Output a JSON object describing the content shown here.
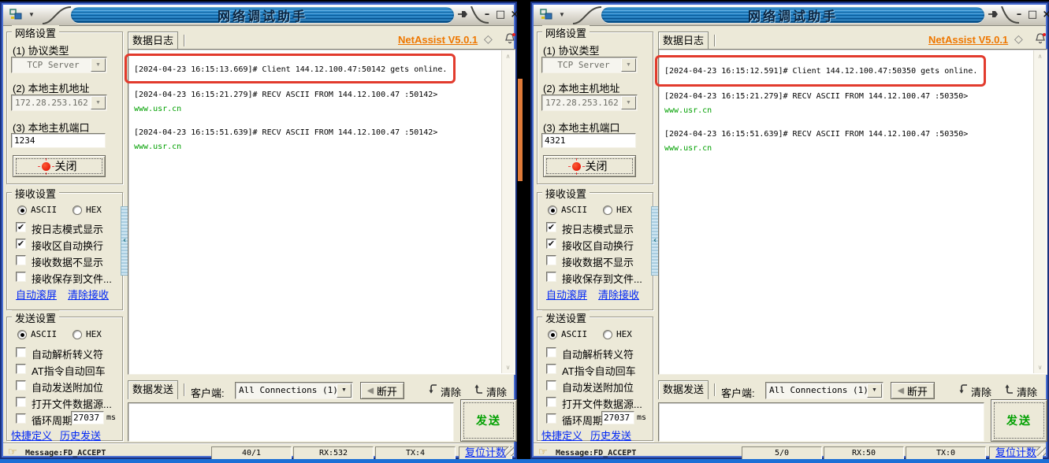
{
  "labels": {
    "title": "网络调试助手",
    "brand": "NetAssist V5.0.1",
    "net_group": "网络设置",
    "protocol_label": "(1) 协议类型",
    "protocol_value": "TCP Server",
    "address_label": "(2) 本地主机地址",
    "address_value": "172.28.253.162",
    "port_label": "(3) 本地主机端口",
    "close_btn": "关闭",
    "recv_group": "接收设置",
    "ascii": "ASCII",
    "hex": "HEX",
    "recv_opts": [
      "按日志模式显示",
      "接收区自动换行",
      "接收数据不显示",
      "接收保存到文件..."
    ],
    "recv_link_scroll": "自动滚屏",
    "recv_link_clear": "清除接收",
    "send_group": "发送设置",
    "send_opts": [
      "自动解析转义符",
      "AT指令自动回车",
      "自动发送附加位",
      "打开文件数据源...",
      "循环周期"
    ],
    "ms_unit": "ms",
    "send_link_quick": "快捷定义",
    "send_link_history": "历史发送",
    "log_tab": "数据日志",
    "send_tab": "数据发送",
    "client_label": "客户端:",
    "client_value": "All Connections (1)",
    "disconnect": "断开",
    "clear": "清除",
    "send_btn": "发送",
    "reset_count": "复位计数",
    "status_message": "Message:FD_ACCEPT"
  },
  "icons": {
    "dropdown": "▼",
    "combo_arrow": "▼",
    "minimize": "–",
    "maximize": "□",
    "close": "×",
    "chevron_left": "‹",
    "scroll_up": "∧",
    "scroll_down": "∨",
    "disconnect_arrow": "◀",
    "status_pointer": "☞",
    "check": "✔",
    "diamond": "◇"
  },
  "windows": [
    {
      "port": "1234",
      "cycle": "27037",
      "log": [
        "[2024-04-23 16:15:13.669]# Client 144.12.100.47:50142 gets online.",
        "[2024-04-23 16:15:21.279]# RECV ASCII FROM 144.12.100.47 :50142>",
        "www.usr.cn",
        "[2024-04-23 16:15:51.639]# RECV ASCII FROM 144.12.100.47 :50142>",
        "www.usr.cn"
      ],
      "counters": {
        "pair": "40/1",
        "rx": "RX:532",
        "tx": "TX:4"
      }
    },
    {
      "port": "4321",
      "cycle": "27037",
      "log": [
        "[2024-04-23 16:15:12.591]# Client 144.12.100.47:50350 gets online.",
        "[2024-04-23 16:15:21.279]# RECV ASCII FROM 144.12.100.47 :50350>",
        "www.usr.cn",
        "[2024-04-23 16:15:51.639]# RECV ASCII FROM 144.12.100.47 :50350>",
        "www.usr.cn"
      ],
      "counters": {
        "pair": "5/0",
        "rx": "RX:50",
        "tx": "TX:0"
      }
    }
  ],
  "colors": {
    "title_blue": "#1478c0",
    "brand_orange": "#ee7700",
    "link_blue": "#0026f5",
    "log_green": "#00a000",
    "annotation_red": "#e23b2d",
    "send_green": "#00a000"
  }
}
